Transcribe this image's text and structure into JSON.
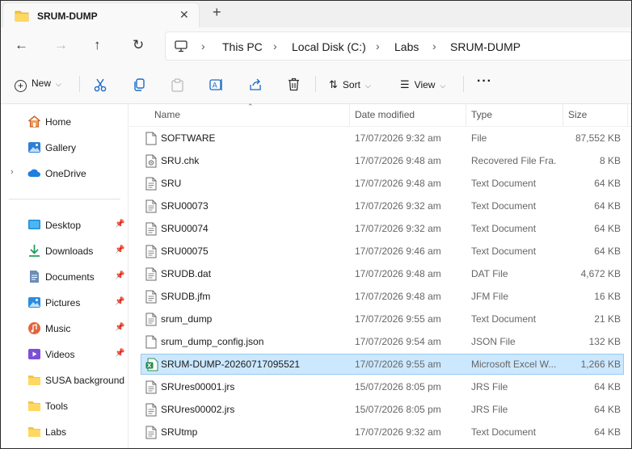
{
  "tab": {
    "title": "SRUM-DUMP",
    "close_glyph": "✕",
    "new_tab_glyph": "+"
  },
  "breadcrumb": [
    "This PC",
    "Local Disk (C:)",
    "Labs",
    "SRUM-DUMP"
  ],
  "toolbar": {
    "new_label": "New",
    "sort_label": "Sort",
    "view_label": "View",
    "more_label": "···"
  },
  "sidebar": {
    "top": [
      {
        "label": "Home",
        "icon": "home-icon"
      },
      {
        "label": "Gallery",
        "icon": "gallery-icon"
      },
      {
        "label": "OneDrive",
        "icon": "cloud-icon"
      }
    ],
    "quick": [
      {
        "label": "Desktop",
        "icon": "desktop-icon",
        "pinned": true
      },
      {
        "label": "Downloads",
        "icon": "download-icon",
        "pinned": true
      },
      {
        "label": "Documents",
        "icon": "documents-icon",
        "pinned": true
      },
      {
        "label": "Pictures",
        "icon": "pictures-icon",
        "pinned": true
      },
      {
        "label": "Music",
        "icon": "music-icon",
        "pinned": true
      },
      {
        "label": "Videos",
        "icon": "videos-icon",
        "pinned": true
      },
      {
        "label": "SUSA background",
        "icon": "folder-icon",
        "pinned": false
      },
      {
        "label": "Tools",
        "icon": "folder-icon",
        "pinned": false
      },
      {
        "label": "Labs",
        "icon": "folder-icon",
        "pinned": false
      }
    ]
  },
  "columns": {
    "name": "Name",
    "date": "Date modified",
    "type": "Type",
    "size": "Size"
  },
  "files": [
    {
      "name": "SOFTWARE",
      "date": "17/07/2026 9:32 am",
      "type": "File",
      "size": "87,552 KB",
      "icon": "file-icon"
    },
    {
      "name": "SRU.chk",
      "date": "17/07/2026 9:48 am",
      "type": "Recovered File Fra...",
      "size": "8 KB",
      "icon": "recovered-file-icon"
    },
    {
      "name": "SRU",
      "date": "17/07/2026 9:48 am",
      "type": "Text Document",
      "size": "64 KB",
      "icon": "text-file-icon"
    },
    {
      "name": "SRU00073",
      "date": "17/07/2026 9:32 am",
      "type": "Text Document",
      "size": "64 KB",
      "icon": "text-file-icon"
    },
    {
      "name": "SRU00074",
      "date": "17/07/2026 9:32 am",
      "type": "Text Document",
      "size": "64 KB",
      "icon": "text-file-icon"
    },
    {
      "name": "SRU00075",
      "date": "17/07/2026 9:46 am",
      "type": "Text Document",
      "size": "64 KB",
      "icon": "text-file-icon"
    },
    {
      "name": "SRUDB.dat",
      "date": "17/07/2026 9:48 am",
      "type": "DAT File",
      "size": "4,672 KB",
      "icon": "text-file-icon"
    },
    {
      "name": "SRUDB.jfm",
      "date": "17/07/2026 9:48 am",
      "type": "JFM File",
      "size": "16 KB",
      "icon": "text-file-icon"
    },
    {
      "name": "srum_dump",
      "date": "17/07/2026 9:55 am",
      "type": "Text Document",
      "size": "21 KB",
      "icon": "text-file-icon"
    },
    {
      "name": "srum_dump_config.json",
      "date": "17/07/2026 9:54 am",
      "type": "JSON File",
      "size": "132 KB",
      "icon": "file-icon"
    },
    {
      "name": "SRUM-DUMP-20260717095521",
      "date": "17/07/2026 9:55 am",
      "type": "Microsoft Excel W...",
      "size": "1,266 KB",
      "icon": "excel-icon",
      "selected": true
    },
    {
      "name": "SRUres00001.jrs",
      "date": "15/07/2026 8:05 pm",
      "type": "JRS File",
      "size": "64 KB",
      "icon": "text-file-icon"
    },
    {
      "name": "SRUres00002.jrs",
      "date": "15/07/2026 8:05 pm",
      "type": "JRS File",
      "size": "64 KB",
      "icon": "text-file-icon"
    },
    {
      "name": "SRUtmp",
      "date": "17/07/2026 9:32 am",
      "type": "Text Document",
      "size": "64 KB",
      "icon": "text-file-icon"
    }
  ],
  "colors": {
    "accent": "#0067c0",
    "selection": "#cce8ff",
    "folder": "#f4c542"
  }
}
